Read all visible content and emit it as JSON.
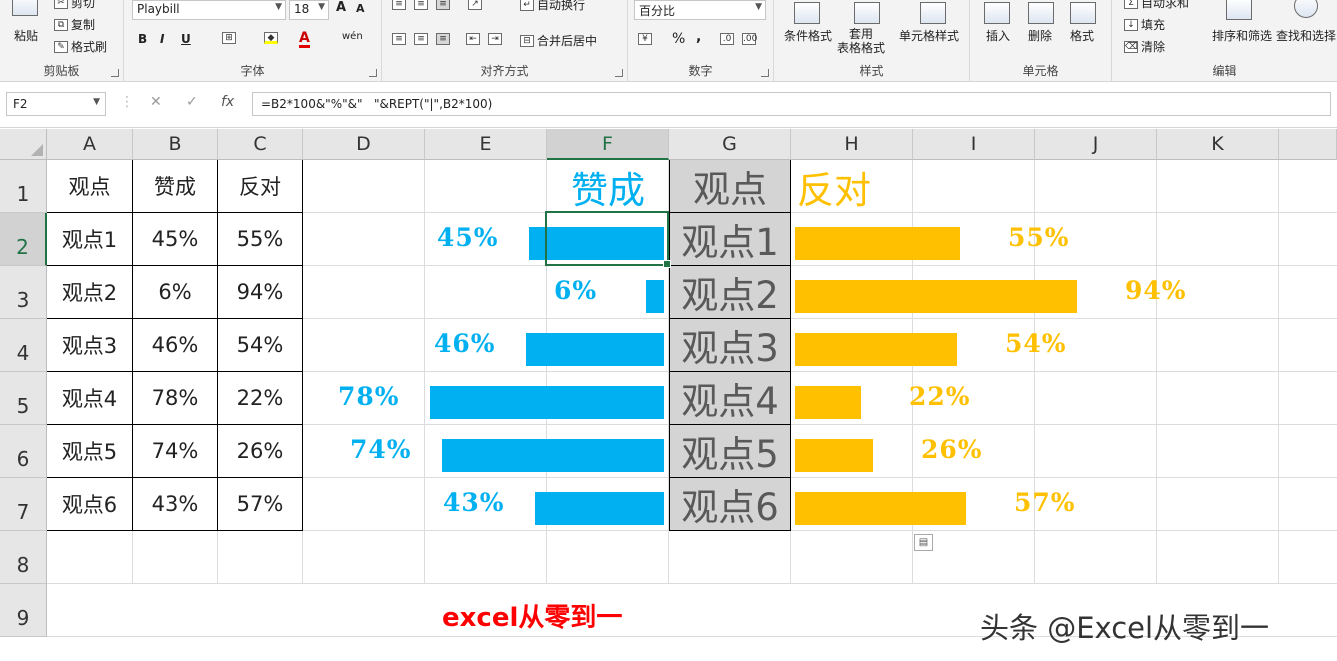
{
  "ribbon": {
    "clipboard": {
      "label": "剪贴板",
      "cut": "剪切",
      "copy": "复制",
      "format_painter": "格式刷",
      "paste": "粘贴"
    },
    "font": {
      "label": "字体",
      "name": "Playbill",
      "size": "18",
      "grow": "A",
      "shrink": "A",
      "bold": "B",
      "italic": "I",
      "underline": "U",
      "phonetic": "wén"
    },
    "alignment": {
      "label": "对齐方式",
      "wrap_text": "自动换行",
      "merge_center": "合并后居中"
    },
    "number": {
      "label": "数字",
      "format": "百分比",
      "percent": "%",
      "comma": ","
    },
    "styles": {
      "label": "样式",
      "conditional": "条件格式",
      "table_format": "套用\n表格格式",
      "cell_styles": "单元格样式"
    },
    "cells": {
      "label": "单元格",
      "insert": "插入",
      "delete": "删除",
      "format": "格式"
    },
    "editing": {
      "label": "编辑",
      "autosum": "自动求和",
      "fill": "填充",
      "clear": "清除",
      "sort_filter": "排序和筛选",
      "find_select": "查找和选择"
    }
  },
  "formula_bar": {
    "name_box": "F2",
    "cancel": "✕",
    "enter": "✓",
    "fx": "fx",
    "formula": "=B2*100&\"%\"&\"   \"&REPT(\"|\",B2*100)"
  },
  "sheet": {
    "columns": [
      "A",
      "B",
      "C",
      "D",
      "E",
      "F",
      "G",
      "H",
      "I",
      "J",
      "K"
    ],
    "rows": [
      "1",
      "2",
      "3",
      "4",
      "5",
      "6",
      "7",
      "8",
      "9"
    ],
    "selected_cell": "F2",
    "table_headers": [
      "观点",
      "赞成",
      "反对"
    ],
    "table_rows": [
      [
        "观点1",
        "45%",
        "55%"
      ],
      [
        "观点2",
        "6%",
        "94%"
      ],
      [
        "观点3",
        "46%",
        "54%"
      ],
      [
        "观点4",
        "78%",
        "22%"
      ],
      [
        "观点5",
        "74%",
        "26%"
      ],
      [
        "观点6",
        "43%",
        "57%"
      ]
    ],
    "chart_header_support": "赞成",
    "chart_header_point": "观点",
    "chart_header_oppose": "反对",
    "chart_rows": [
      {
        "label": "观点1",
        "support": 45,
        "oppose": 55,
        "support_text": "45%",
        "oppose_text": "55%"
      },
      {
        "label": "观点2",
        "support": 6,
        "oppose": 94,
        "support_text": "6%",
        "oppose_text": "94%"
      },
      {
        "label": "观点3",
        "support": 46,
        "oppose": 54,
        "support_text": "46%",
        "oppose_text": "54%"
      },
      {
        "label": "观点4",
        "support": 78,
        "oppose": 22,
        "support_text": "78%",
        "oppose_text": "22%"
      },
      {
        "label": "观点5",
        "support": 74,
        "oppose": 26,
        "support_text": "74%",
        "oppose_text": "26%"
      },
      {
        "label": "观点6",
        "support": 43,
        "oppose": 57,
        "support_text": "43%",
        "oppose_text": "57%"
      }
    ],
    "support_color": "#00b0f0",
    "oppose_color": "#ffc000",
    "footer_text": "excel从零到一"
  },
  "watermark": "头条 @Excel从零到一"
}
